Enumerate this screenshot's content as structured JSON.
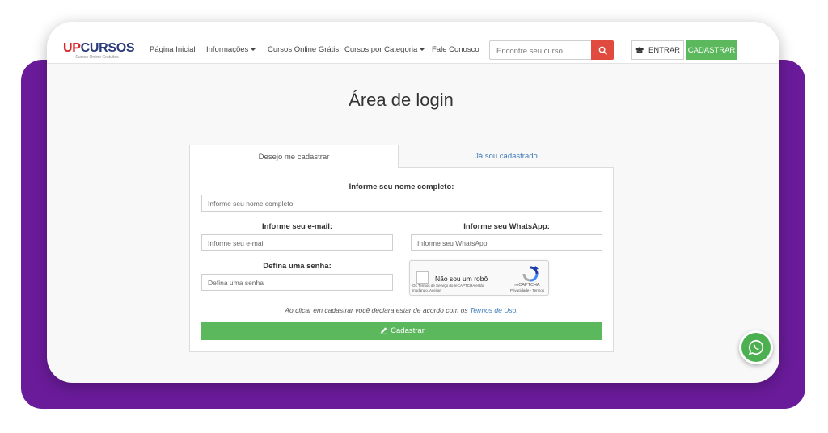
{
  "brand": {
    "logo_up": "UP",
    "logo_rest": "CURSOS",
    "tagline": "Cursos Online Gratuitos"
  },
  "nav": {
    "items": [
      {
        "label": "Página Inicial",
        "has_dropdown": false
      },
      {
        "label": "Informações",
        "has_dropdown": true
      },
      {
        "label": "Cursos Online Grátis",
        "has_dropdown": false
      },
      {
        "label": "Cursos por Categoria",
        "has_dropdown": true
      },
      {
        "label": "Fale Conosco",
        "has_dropdown": false
      }
    ],
    "search_placeholder": "Encontre seu curso...",
    "login_label": "ENTRAR",
    "signup_label": "CADASTRAR"
  },
  "page": {
    "title": "Área de login"
  },
  "tabs": [
    {
      "label": "Desejo me cadastrar",
      "active": true
    },
    {
      "label": "Já sou cadastrado",
      "active": false
    }
  ],
  "form": {
    "name_label": "Informe seu nome completo:",
    "name_placeholder": "Informe seu nome completo",
    "email_label": "Informe seu e-mail:",
    "email_placeholder": "Informe seu e-mail",
    "whatsapp_label": "Informe seu WhatsApp:",
    "whatsapp_placeholder": "Informe seu WhatsApp",
    "password_label": "Defina uma senha:",
    "password_placeholder": "Defina uma senha",
    "captcha": {
      "text": "Não sou um robô",
      "brand": "reCAPTCHA",
      "links": "Privacidade - Termos",
      "terms": "Os Termos de Serviço do reCAPTCHA estão mudando. Aceitar."
    },
    "agree_text": "Ao clicar em cadastrar você declara estar de acordo com os ",
    "agree_link": "Termos de Uso",
    "agree_end": ".",
    "submit_label": "Cadastrar"
  },
  "colors": {
    "brand_blue": "#2a3a7a",
    "brand_red": "#d9262a",
    "success": "#5cb85c",
    "search": "#e04a3f",
    "link": "#3c7ab8",
    "frame": "#6a1b9a"
  },
  "icons": {
    "search": "search-icon",
    "login": "graduation-cap-icon",
    "submit": "pen-signature-icon",
    "whatsapp": "whatsapp-icon",
    "captcha": "recaptcha-icon"
  }
}
